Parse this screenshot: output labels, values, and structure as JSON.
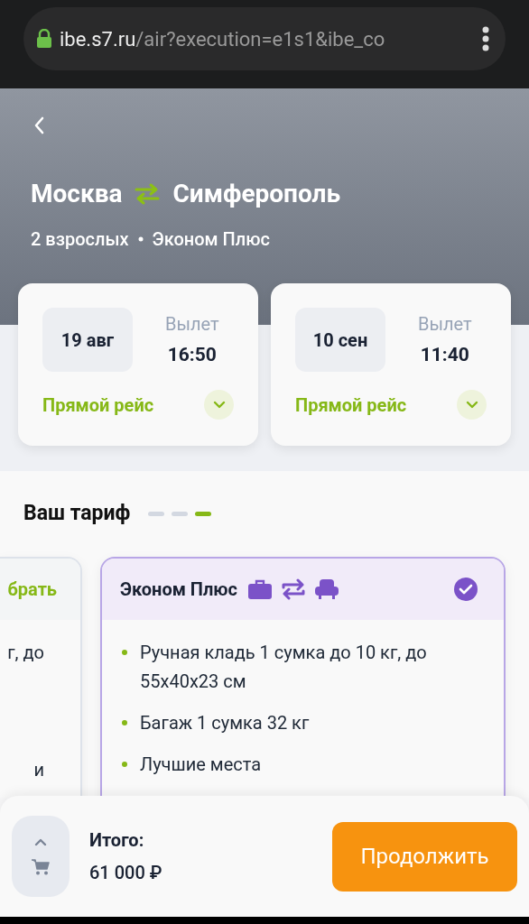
{
  "browser": {
    "url_host": "ibe.s7.ru",
    "url_path": "/air?execution=e1s1&ibe_co"
  },
  "header": {
    "origin": "Москва",
    "destination": "Симферополь",
    "passengers": "2 взрослых",
    "fare_class": "Эконом Плюс"
  },
  "flights": [
    {
      "date": "19 авг",
      "label": "Вылет",
      "time": "16:50",
      "type": "Прямой рейс",
      "expanded": false
    },
    {
      "date": "10 сен",
      "label": "Вылет",
      "time": "11:40",
      "type": "Прямой рейс",
      "expanded": false
    }
  ],
  "tariff": {
    "title": "Ваш тариф",
    "steps": [
      {
        "selected": false
      },
      {
        "selected": false
      },
      {
        "selected": true
      }
    ],
    "fares": [
      {
        "name": "брать",
        "selected": false,
        "features": [
          "г, до",
          "и"
        ]
      },
      {
        "name": "Эконом Плюс",
        "selected": true,
        "features": [
          "Ручная кладь 1 сумка до 10 кг, до 55x40x23 см",
          "Багаж 1 сумка 32 кг",
          "Лучшие места"
        ]
      }
    ]
  },
  "footer": {
    "total_label": "Итого:",
    "total": "61 000 ₽",
    "continue": "Продолжить"
  }
}
